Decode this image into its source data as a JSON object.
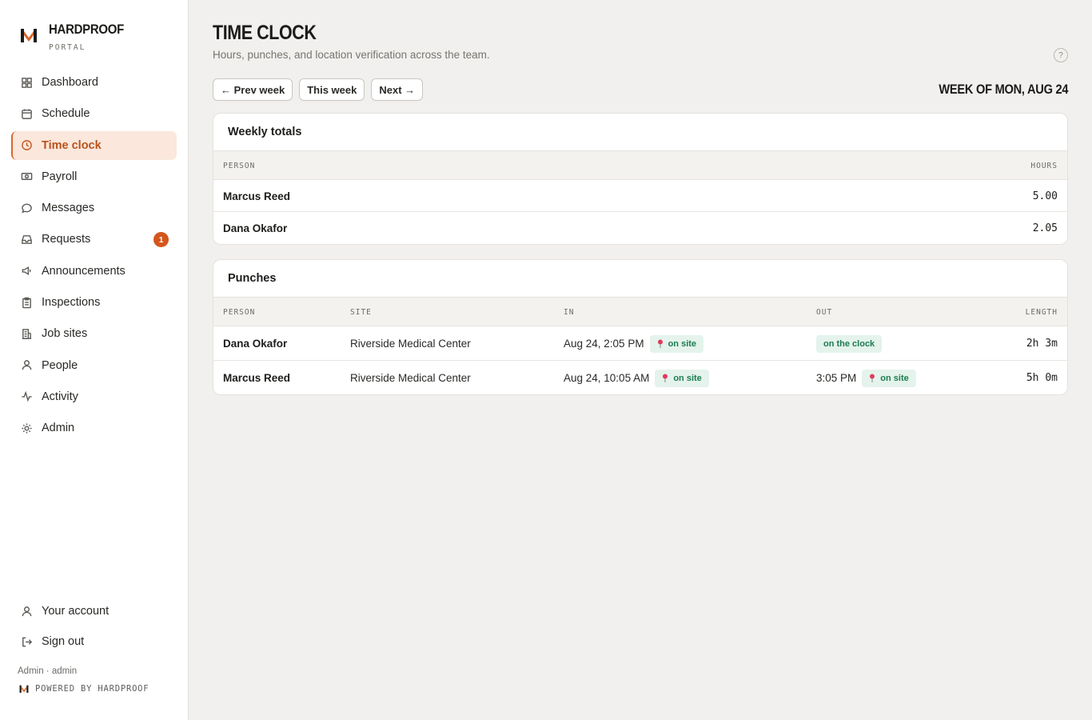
{
  "brand": {
    "name": "HARDPROOF",
    "sub": "PORTAL"
  },
  "nav": {
    "items": [
      {
        "label": "Dashboard",
        "icon": "grid-icon"
      },
      {
        "label": "Schedule",
        "icon": "calendar-icon"
      },
      {
        "label": "Time clock",
        "icon": "clock-icon",
        "active": true
      },
      {
        "label": "Payroll",
        "icon": "money-icon"
      },
      {
        "label": "Messages",
        "icon": "chat-icon"
      },
      {
        "label": "Requests",
        "icon": "inbox-icon",
        "badge": "1"
      },
      {
        "label": "Announcements",
        "icon": "megaphone-icon"
      },
      {
        "label": "Inspections",
        "icon": "clipboard-icon"
      },
      {
        "label": "Job sites",
        "icon": "building-icon"
      },
      {
        "label": "People",
        "icon": "user-icon"
      },
      {
        "label": "Activity",
        "icon": "activity-icon"
      },
      {
        "label": "Admin",
        "icon": "sun-icon"
      }
    ],
    "bottom": [
      {
        "label": "Your account",
        "icon": "user-icon"
      },
      {
        "label": "Sign out",
        "icon": "sign-out-icon"
      }
    ],
    "user_line": "Admin · admin",
    "powered_by": "POWERED BY HARDPROOF"
  },
  "page": {
    "title": "TIME CLOCK",
    "subtitle": "Hours, punches, and location verification across the team.",
    "help": "?",
    "prev_week": "← Prev week",
    "this_week": "This week",
    "next_week": "Next →",
    "week_label": "WEEK OF MON, AUG 24"
  },
  "totals": {
    "title": "Weekly totals",
    "col_person": "PERSON",
    "col_hours": "HOURS",
    "rows": [
      {
        "person": "Marcus Reed",
        "hours": "5.00"
      },
      {
        "person": "Dana Okafor",
        "hours": "2.05"
      }
    ]
  },
  "punches": {
    "title": "Punches",
    "col_person": "PERSON",
    "col_site": "SITE",
    "col_in": "IN",
    "col_out": "OUT",
    "col_length": "LENGTH",
    "rows": [
      {
        "person": "Dana Okafor",
        "site": "Riverside Medical Center",
        "in_time": "Aug 24, 2:05 PM",
        "in_status": "on site",
        "out_time": "",
        "out_status": "on the clock",
        "length": "2h 3m"
      },
      {
        "person": "Marcus Reed",
        "site": "Riverside Medical Center",
        "in_time": "Aug 24, 10:05 AM",
        "in_status": "on site",
        "out_time": "3:05 PM",
        "out_status": "on site",
        "length": "5h 0m"
      }
    ]
  },
  "colors": {
    "accent": "#d4561c",
    "active_bg": "#fbe7dc",
    "pill_bg": "#e4f3ec",
    "pill_text": "#1c7c4f",
    "pin": "#e23b5a"
  }
}
